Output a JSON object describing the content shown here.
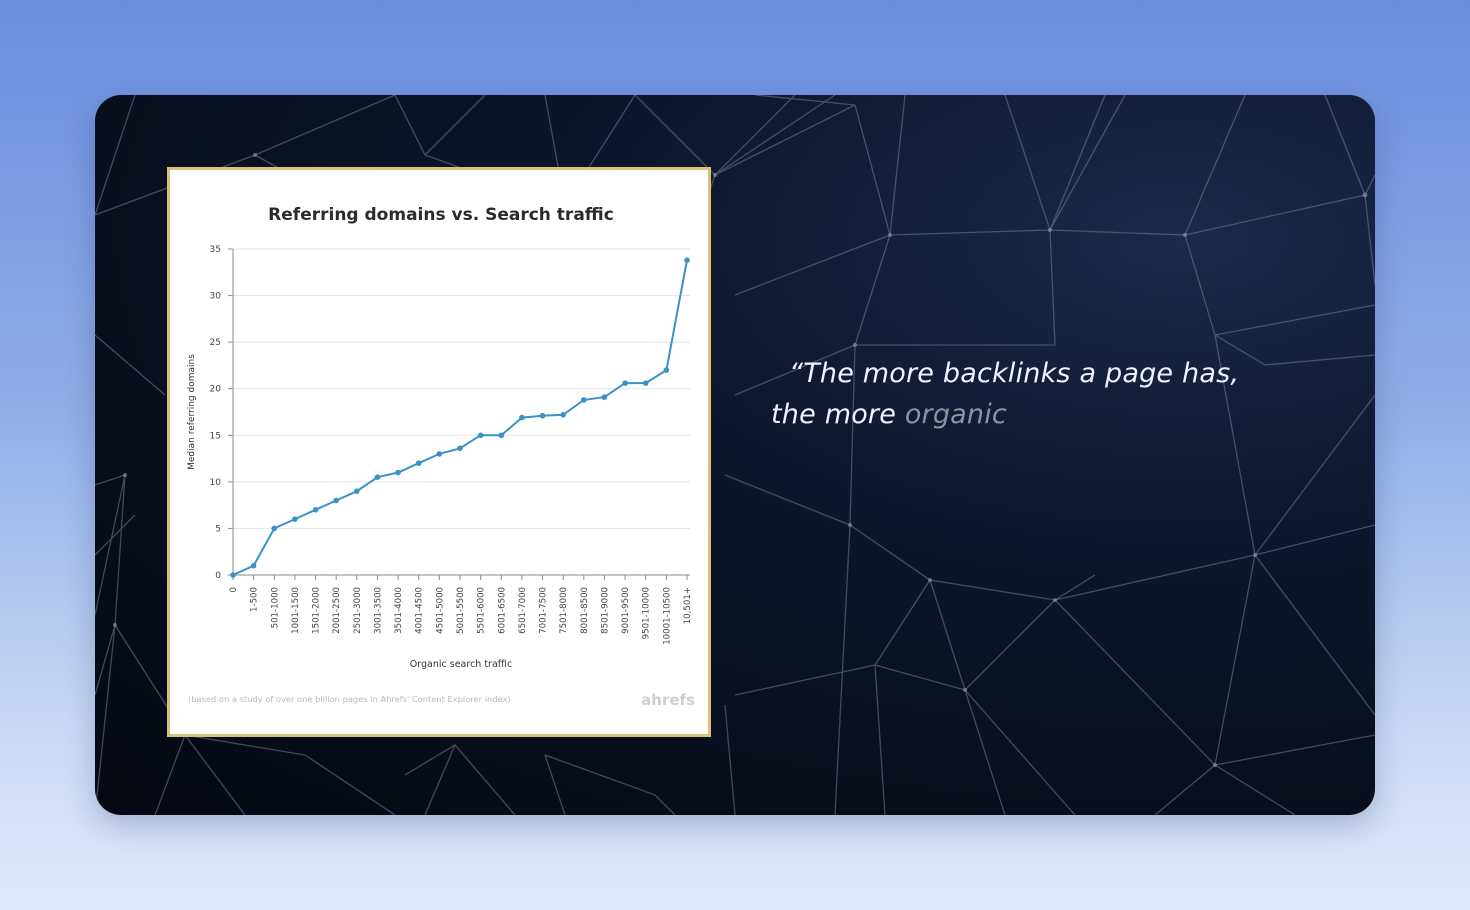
{
  "colors": {
    "page_background": "#7d9fe4",
    "slide_background": "#0a1222",
    "line": "#3a93c6",
    "card_border": "#d8c27a",
    "quote_text": "#eef3ff",
    "quote_faded": "#8c93a3"
  },
  "quote": {
    "line1": "“The more backlinks a page has,",
    "line2_start": "the more ",
    "line2_faded": "organic"
  },
  "chart_footer": {
    "note": "(based on a study of over one billion pages in Ahrefs' Content Explorer index)",
    "brand": "ahrefs"
  },
  "chart_data": {
    "type": "line",
    "title": "Referring domains vs. Search traffic",
    "xlabel": "Organic search traffic",
    "ylabel": "Median referring domains",
    "ylim": [
      0,
      35
    ],
    "yticks": [
      0,
      5,
      10,
      15,
      20,
      25,
      30,
      35
    ],
    "grid": true,
    "categories": [
      "0",
      "1-500",
      "501-1000",
      "1001-1500",
      "1501-2000",
      "2001-2500",
      "2501-3000",
      "3001-3500",
      "3501-4000",
      "4001-4500",
      "4501-5000",
      "5001-5500",
      "5501-6000",
      "6001-6500",
      "6501-7000",
      "7001-7500",
      "7501-8000",
      "8001-8500",
      "8501-9000",
      "9001-9500",
      "9501-10000",
      "10001-10500",
      "10,501+"
    ],
    "values": [
      0,
      1,
      5,
      6,
      7,
      8,
      9,
      10.5,
      11,
      12,
      13,
      13.6,
      15,
      15,
      16.9,
      17.1,
      17.2,
      18.8,
      19.1,
      20.6,
      20.6,
      22,
      33.8
    ]
  }
}
